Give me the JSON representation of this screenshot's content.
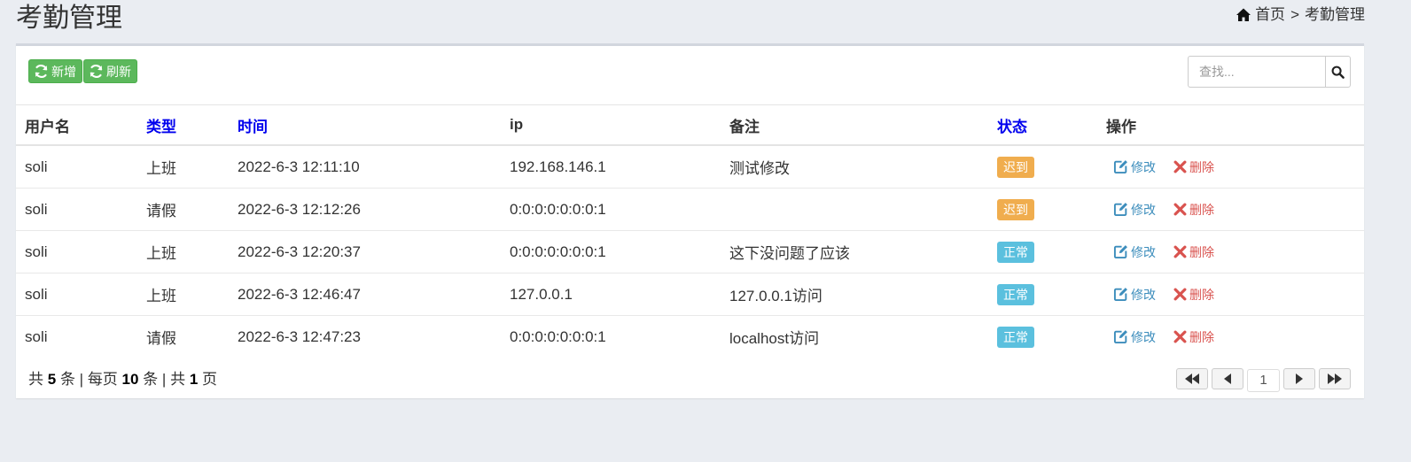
{
  "page": {
    "title": "考勤管理"
  },
  "breadcrumb": {
    "home": "首页",
    "sep": ">",
    "current": "考勤管理"
  },
  "toolbar": {
    "add_label": "新增",
    "refresh_label": "刷新"
  },
  "search": {
    "placeholder": "查找..."
  },
  "table": {
    "headers": [
      "用户名",
      "类型",
      "时间",
      "ip",
      "备注",
      "状态",
      "操作"
    ],
    "rows": [
      {
        "user": "soli",
        "type": "上班",
        "time": "2022-6-3 12:11:10",
        "ip": "192.168.146.1",
        "note": "测试修改",
        "status": "迟到",
        "status_color": "#f0ad4e"
      },
      {
        "user": "soli",
        "type": "请假",
        "time": "2022-6-3 12:12:26",
        "ip": "0:0:0:0:0:0:0:1",
        "note": "",
        "status": "迟到",
        "status_color": "#f0ad4e"
      },
      {
        "user": "soli",
        "type": "上班",
        "time": "2022-6-3 12:20:37",
        "ip": "0:0:0:0:0:0:0:1",
        "note": "这下没问题了应该",
        "status": "正常",
        "status_color": "#5bc0de"
      },
      {
        "user": "soli",
        "type": "上班",
        "time": "2022-6-3 12:46:47",
        "ip": "127.0.0.1",
        "note": "127.0.0.1访问",
        "status": "正常",
        "status_color": "#5bc0de"
      },
      {
        "user": "soli",
        "type": "请假",
        "time": "2022-6-3 12:47:23",
        "ip": "0:0:0:0:0:0:0:1",
        "note": "localhost访问",
        "status": "正常",
        "status_color": "#5bc0de"
      }
    ],
    "edit_label": "修改",
    "delete_label": "删除"
  },
  "footer": {
    "total_prefix": "共",
    "total": "5",
    "total_unit": "条",
    "per_page_prefix": "每页",
    "per_page": "10",
    "per_page_unit": "条",
    "pages_prefix": "共",
    "pages": "1",
    "pages_unit": "页"
  },
  "pager": {
    "current": "1"
  },
  "colors": {
    "green": "#5cb85c",
    "link": "#3c8dbc",
    "danger": "#d9534f",
    "warning": "#f0ad4e",
    "info": "#5bc0de",
    "sort_header": "#0000ee"
  },
  "icons": {
    "home": "home-icon",
    "refresh": "refresh-icon",
    "search": "search-icon",
    "edit": "edit-icon",
    "delete": "delete-icon"
  }
}
